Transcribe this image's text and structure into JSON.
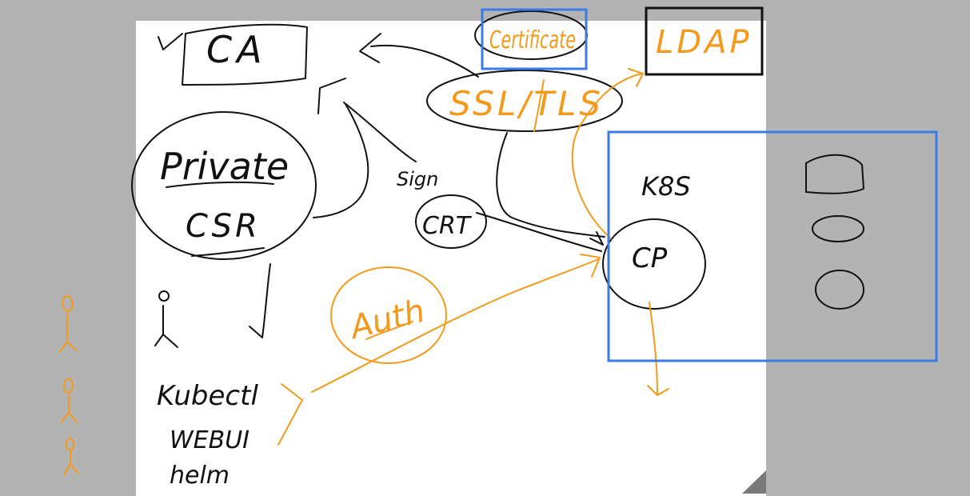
{
  "canvas": {
    "background": "#b3b3b3",
    "paper_color": "#ffffff",
    "black_ink": "#111111",
    "orange_ink": "#f39a1c",
    "blue_box": "#3b7be4"
  },
  "labels": {
    "ca": "CA",
    "private": "Private",
    "csr": "CSR",
    "sign": "Sign",
    "crt": "CRT",
    "k8s": "K8S",
    "cp": "CP",
    "kubectl": "Kubectl",
    "webui": "WEBUI",
    "helm": "helm",
    "ssl_tls": "SSL/TLS",
    "certificate": "Certificate",
    "ldap": "LDAP",
    "auth": "Auth"
  }
}
